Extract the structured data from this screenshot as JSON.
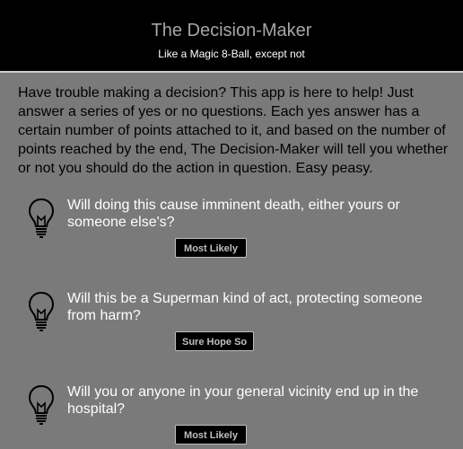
{
  "header": {
    "title": "The Decision-Maker",
    "subtitle": "Like a Magic 8-Ball, except not"
  },
  "intro": "Have trouble making a decision? This app is here to help! Just answer a series of yes or no questions. Each yes answer has a certain number of points attached to it, and based on the number of points reached by the end, The Decision-Maker will tell you whether or not you should do the action in question. Easy peasy.",
  "questions": [
    {
      "text": "Will doing this cause imminent death, either yours or someone else's?",
      "answer": "Most Likely",
      "icon": "lightbulb-icon"
    },
    {
      "text": "Will this be a Superman kind of act, protecting someone from harm?",
      "answer": "Sure Hope So",
      "icon": "lightbulb-icon"
    },
    {
      "text": "Will you or anyone in your general vicinity end up in the hospital?",
      "answer": "Most Likely",
      "icon": "lightbulb-icon"
    }
  ],
  "colors": {
    "header_bg": "#000000",
    "page_bg": "#7a7a7a",
    "question_text": "#ffffff",
    "button_bg": "#000000"
  }
}
